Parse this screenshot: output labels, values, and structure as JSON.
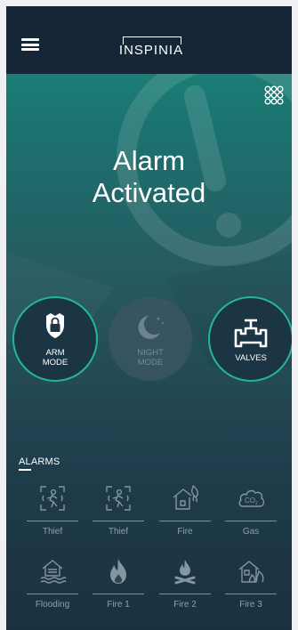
{
  "header": {
    "logo": "INSPINIA",
    "menu_icon": "hamburger-icon",
    "grid_icon": "grid-icon"
  },
  "status": {
    "line1": "Alarm",
    "line2": "Activated"
  },
  "modes": [
    {
      "label1": "ARM",
      "label2": "MODE",
      "icon": "shield-lock-icon",
      "active": true
    },
    {
      "label1": "NIGHT",
      "label2": "MODE",
      "icon": "moon-icon",
      "active": false
    },
    {
      "label1": "VALVES",
      "label2": "",
      "icon": "valve-icon",
      "active": true
    }
  ],
  "alarms": {
    "title": "ALARMS",
    "items": [
      {
        "label": "Thief",
        "icon": "thief-sensor-icon"
      },
      {
        "label": "Thief",
        "icon": "thief-sensor-icon"
      },
      {
        "label": "Fire",
        "icon": "house-fire-icon"
      },
      {
        "label": "Gas",
        "icon": "co2-cloud-icon"
      },
      {
        "label": "Flooding",
        "icon": "flooding-house-icon"
      },
      {
        "label": "Fire 1",
        "icon": "flame-icon"
      },
      {
        "label": "Fire 2",
        "icon": "campfire-icon"
      },
      {
        "label": "Fire 3",
        "icon": "burning-house-icon"
      }
    ]
  },
  "colors": {
    "accent": "#25b49d",
    "topbar": "#152637",
    "gradient_top": "#1c8c7f",
    "gradient_bottom": "#1a3140"
  }
}
